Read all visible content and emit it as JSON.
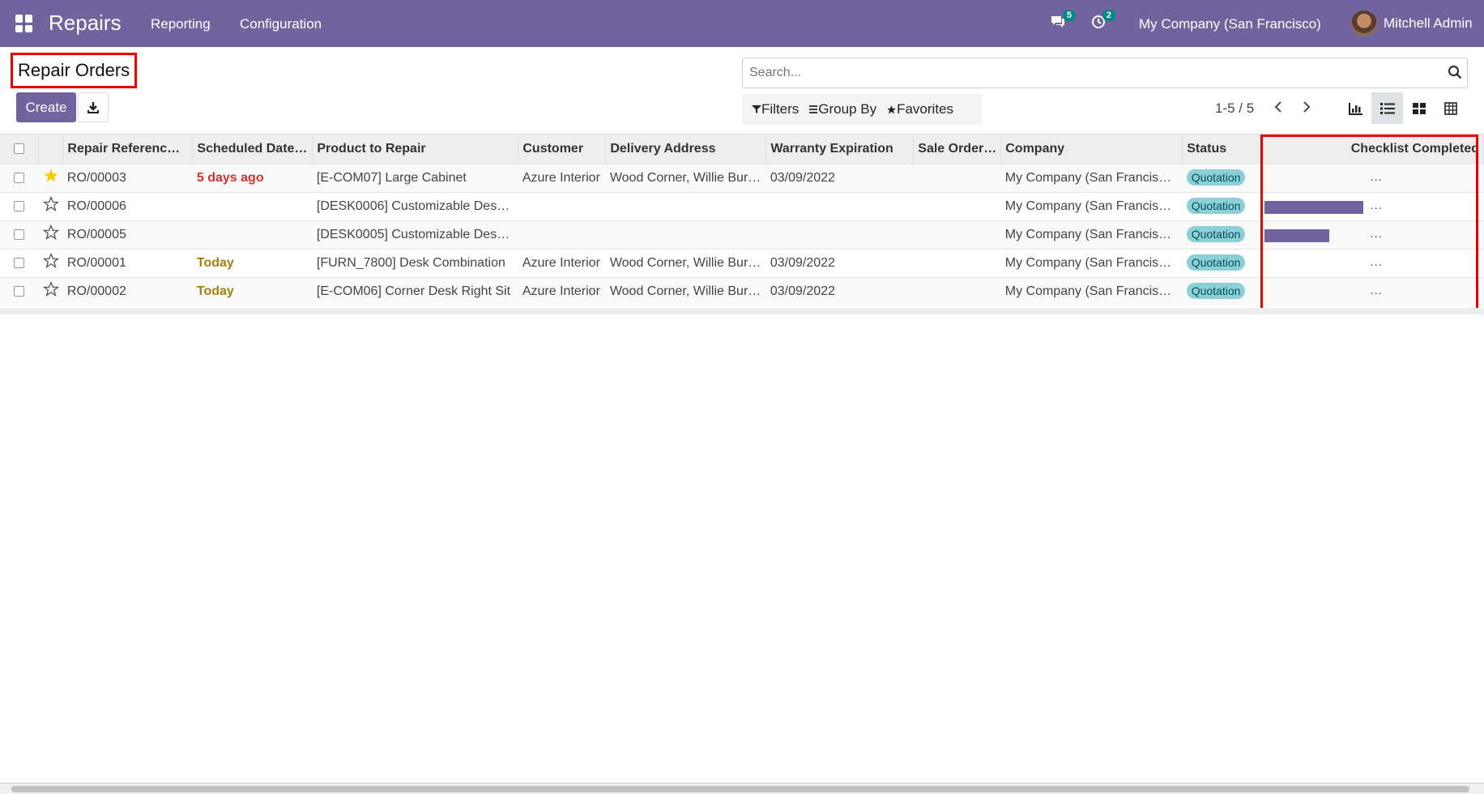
{
  "nav": {
    "app_title": "Repairs",
    "menu": [
      "Reporting",
      "Configuration"
    ],
    "messages_count": "5",
    "activities_count": "2",
    "company": "My Company (San Francisco)",
    "user": "Mitchell Admin"
  },
  "control": {
    "page_title": "Repair Orders",
    "create_label": "Create",
    "search_placeholder": "Search...",
    "filters_label": "Filters",
    "groupby_label": "Group By",
    "favorites_label": "Favorites",
    "pager": "1-5 / 5"
  },
  "table": {
    "headers": [
      "Repair Referenc…",
      "Scheduled Date…",
      "Product to Repair",
      "Customer",
      "Delivery Address",
      "Warranty Expiration",
      "Sale Order…",
      "Company",
      "Status",
      "Checklist Completed"
    ],
    "rows": [
      {
        "starred": true,
        "ref": "RO/00003",
        "date": "5 days ago",
        "date_style": "late",
        "product": "[E-COM07] Large Cabinet",
        "customer": "Azure Interior",
        "address": "Wood Corner, Willie Bur…",
        "warranty": "03/09/2022",
        "sale": "",
        "company": "My Company (San Francis…",
        "status": "Quotation",
        "checklist": 0,
        "checklist_dots": "…"
      },
      {
        "starred": false,
        "ref": "RO/00006",
        "date": "",
        "date_style": "",
        "product": "[DESK0006] Customizable Des…",
        "customer": "",
        "address": "",
        "warranty": "",
        "sale": "",
        "company": "My Company (San Francis…",
        "status": "Quotation",
        "checklist": 100,
        "checklist_dots": "…"
      },
      {
        "starred": false,
        "ref": "RO/00005",
        "date": "",
        "date_style": "",
        "product": "[DESK0005] Customizable Des…",
        "customer": "",
        "address": "",
        "warranty": "",
        "sale": "",
        "company": "My Company (San Francis…",
        "status": "Quotation",
        "checklist": 66,
        "checklist_dots": "…"
      },
      {
        "starred": false,
        "ref": "RO/00001",
        "date": "Today",
        "date_style": "today",
        "product": "[FURN_7800] Desk Combination",
        "customer": "Azure Interior",
        "address": "Wood Corner, Willie Bur…",
        "warranty": "03/09/2022",
        "sale": "",
        "company": "My Company (San Francis…",
        "status": "Quotation",
        "checklist": 0,
        "checklist_dots": "…"
      },
      {
        "starred": false,
        "ref": "RO/00002",
        "date": "Today",
        "date_style": "today",
        "product": "[E-COM06] Corner Desk Right Sit",
        "customer": "Azure Interior",
        "address": "Wood Corner, Willie Bur…",
        "warranty": "03/09/2022",
        "sale": "",
        "company": "My Company (San Francis…",
        "status": "Quotation",
        "checklist": 0,
        "checklist_dots": "…"
      }
    ]
  },
  "colors": {
    "brand": "#71639e",
    "late": "#d9312b",
    "today": "#a6800c",
    "status_bg": "#8ccfd8"
  }
}
